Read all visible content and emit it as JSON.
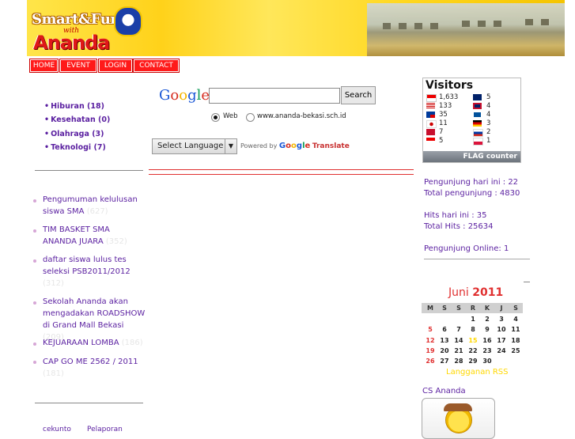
{
  "header": {
    "logo_line1": "Smart&Fun",
    "logo_with": "with",
    "logo_line2": "Ananda"
  },
  "nav": {
    "home": "HOME",
    "event": "EVENT",
    "login": "LOGIN",
    "contact": "CONTACT"
  },
  "categories": [
    {
      "label": "Hiburan (18)"
    },
    {
      "label": "Kesehatan (0)"
    },
    {
      "label": "Olahraga (3)"
    },
    {
      "label": "Teknologi (7)"
    }
  ],
  "posts": [
    {
      "title": "Pengumuman kelulusan siswa SMA",
      "count": "(627)"
    },
    {
      "title": "TIM BASKET SMA ANANDA JUARA",
      "count": "(352)"
    },
    {
      "title": "daftar siswa lulus tes seleksi PSB2011/2012",
      "count": "(312)"
    },
    {
      "title": "Sekolah Ananda akan mengadakan ROADSHOW di Grand Mall Bekasi",
      "count": "(209)"
    },
    {
      "title": "KEJUARAAN LOMBA",
      "count": "(186)"
    },
    {
      "title": "CAP GO ME 2562 / 2011",
      "count": "(181)"
    }
  ],
  "bottom_links": {
    "left": "cekunto",
    "right": "Pelaporan"
  },
  "search": {
    "google": "Google",
    "button": "Search",
    "input_value": "",
    "radio_web": "Web",
    "radio_site": "www.ananda-bekasi.sch.id"
  },
  "translate": {
    "select_label": "Select Language",
    "powered_by": "Powered by",
    "google": "Google",
    "translate": "Translate"
  },
  "visitors": {
    "title": "Visitors",
    "left": [
      {
        "flag": "id-flag",
        "count": "1,633"
      },
      {
        "flag": "us-flag",
        "count": "133"
      },
      {
        "flag": "tw-flag",
        "count": "35"
      },
      {
        "flag": "jp-flag",
        "count": "11"
      },
      {
        "flag": "no-flag",
        "count": "7"
      },
      {
        "flag": "sg-flag",
        "count": "5"
      }
    ],
    "right": [
      {
        "flag": "au-flag",
        "count": "5"
      },
      {
        "flag": "gb-flag",
        "count": "4"
      },
      {
        "flag": "is-flag",
        "count": "4"
      },
      {
        "flag": "de-flag",
        "count": "3"
      },
      {
        "flag": "ru-flag",
        "count": "2"
      },
      {
        "flag": "pl-flag",
        "count": "1"
      }
    ],
    "footer": "FLAG counter"
  },
  "stats": {
    "today_visitors": "Pengunjung hari ini : 22",
    "total_visitors": "Total pengunjung : 4830",
    "hits_today": "Hits hari ini : 35",
    "total_hits": "Total Hits : 25634",
    "online": "Pengunjung Online: 1"
  },
  "calendar": {
    "month": "Juni",
    "year": "2011",
    "headers": [
      "M",
      "S",
      "S",
      "R",
      "K",
      "J",
      "S"
    ],
    "weeks": [
      [
        "",
        "",
        "",
        "1",
        "2",
        "3",
        "4"
      ],
      [
        "5",
        "6",
        "7",
        "8",
        "9",
        "10",
        "11"
      ],
      [
        "12",
        "13",
        "14",
        "15",
        "16",
        "17",
        "18"
      ],
      [
        "19",
        "20",
        "21",
        "22",
        "23",
        "24",
        "25"
      ],
      [
        "26",
        "27",
        "28",
        "29",
        "30",
        "",
        ""
      ]
    ],
    "rss": "Langganan RSS"
  },
  "cs": {
    "title": "CS Ananda"
  },
  "colors": {
    "nav": "#ff1a1a",
    "accent": "#5a1fa0",
    "sunday": "#e03030",
    "today": "#ffd800"
  }
}
